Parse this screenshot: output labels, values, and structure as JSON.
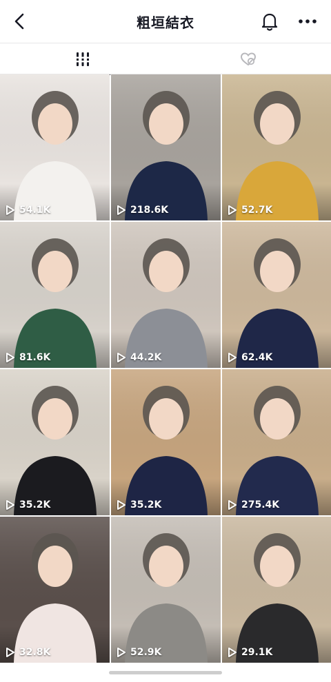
{
  "header": {
    "title": "粗垣結衣",
    "back_icon": "back-chevron-icon",
    "bell_icon": "bell-icon",
    "more_icon": "more-dots-icon"
  },
  "tabs": [
    {
      "icon": "grid-videos-icon",
      "selected": true
    },
    {
      "icon": "liked-heart-icon",
      "selected": false
    }
  ],
  "colors": {
    "text_primary": "#161823",
    "tab_inactive": "#b8b8bc",
    "overlay_text": "#ffffff"
  },
  "videos": [
    {
      "views": "54.1K",
      "bg": "#e9e4e0",
      "accent": "#f3f1ee"
    },
    {
      "views": "218.6K",
      "bg": "#a8a39d",
      "accent": "#1d2847"
    },
    {
      "views": "52.7K",
      "bg": "#c9b591",
      "accent": "#d9a73a"
    },
    {
      "views": "81.6K",
      "bg": "#d7d2cb",
      "accent": "#2f5d45"
    },
    {
      "views": "44.2K",
      "bg": "#cfc6bd",
      "accent": "#8c8f96"
    },
    {
      "views": "62.4K",
      "bg": "#cdb89c",
      "accent": "#1f2748"
    },
    {
      "views": "35.2K",
      "bg": "#d9d3c9",
      "accent": "#1b1b1f"
    },
    {
      "views": "35.2K",
      "bg": "#c7a57e",
      "accent": "#1e2545"
    },
    {
      "views": "275.4K",
      "bg": "#c8ad8a",
      "accent": "#222a4d"
    },
    {
      "views": "32.8K",
      "bg": "#5a4f4b",
      "accent": "#f0e5e2"
    },
    {
      "views": "52.9K",
      "bg": "#c4bdb5",
      "accent": "#8c8a86"
    },
    {
      "views": "29.1K",
      "bg": "#c9b89f",
      "accent": "#2a2a2c"
    }
  ]
}
